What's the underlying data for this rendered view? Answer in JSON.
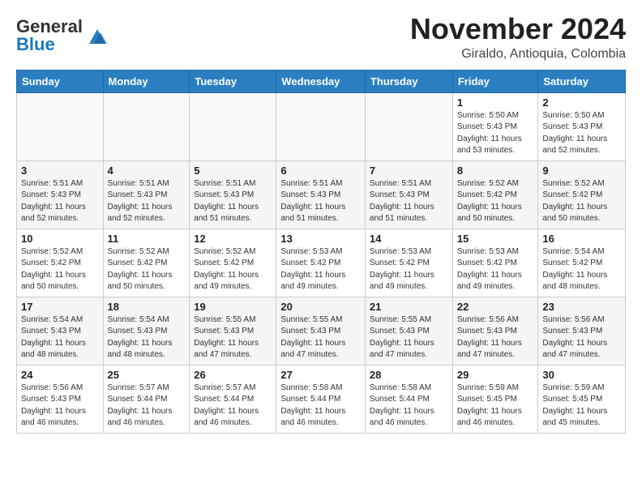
{
  "header": {
    "logo_general": "General",
    "logo_blue": "Blue",
    "month_title": "November 2024",
    "location": "Giraldo, Antioquia, Colombia"
  },
  "weekdays": [
    "Sunday",
    "Monday",
    "Tuesday",
    "Wednesday",
    "Thursday",
    "Friday",
    "Saturday"
  ],
  "weeks": [
    [
      {
        "day": "",
        "info": ""
      },
      {
        "day": "",
        "info": ""
      },
      {
        "day": "",
        "info": ""
      },
      {
        "day": "",
        "info": ""
      },
      {
        "day": "",
        "info": ""
      },
      {
        "day": "1",
        "info": "Sunrise: 5:50 AM\nSunset: 5:43 PM\nDaylight: 11 hours\nand 53 minutes."
      },
      {
        "day": "2",
        "info": "Sunrise: 5:50 AM\nSunset: 5:43 PM\nDaylight: 11 hours\nand 52 minutes."
      }
    ],
    [
      {
        "day": "3",
        "info": "Sunrise: 5:51 AM\nSunset: 5:43 PM\nDaylight: 11 hours\nand 52 minutes."
      },
      {
        "day": "4",
        "info": "Sunrise: 5:51 AM\nSunset: 5:43 PM\nDaylight: 11 hours\nand 52 minutes."
      },
      {
        "day": "5",
        "info": "Sunrise: 5:51 AM\nSunset: 5:43 PM\nDaylight: 11 hours\nand 51 minutes."
      },
      {
        "day": "6",
        "info": "Sunrise: 5:51 AM\nSunset: 5:43 PM\nDaylight: 11 hours\nand 51 minutes."
      },
      {
        "day": "7",
        "info": "Sunrise: 5:51 AM\nSunset: 5:43 PM\nDaylight: 11 hours\nand 51 minutes."
      },
      {
        "day": "8",
        "info": "Sunrise: 5:52 AM\nSunset: 5:42 PM\nDaylight: 11 hours\nand 50 minutes."
      },
      {
        "day": "9",
        "info": "Sunrise: 5:52 AM\nSunset: 5:42 PM\nDaylight: 11 hours\nand 50 minutes."
      }
    ],
    [
      {
        "day": "10",
        "info": "Sunrise: 5:52 AM\nSunset: 5:42 PM\nDaylight: 11 hours\nand 50 minutes."
      },
      {
        "day": "11",
        "info": "Sunrise: 5:52 AM\nSunset: 5:42 PM\nDaylight: 11 hours\nand 50 minutes."
      },
      {
        "day": "12",
        "info": "Sunrise: 5:52 AM\nSunset: 5:42 PM\nDaylight: 11 hours\nand 49 minutes."
      },
      {
        "day": "13",
        "info": "Sunrise: 5:53 AM\nSunset: 5:42 PM\nDaylight: 11 hours\nand 49 minutes."
      },
      {
        "day": "14",
        "info": "Sunrise: 5:53 AM\nSunset: 5:42 PM\nDaylight: 11 hours\nand 49 minutes."
      },
      {
        "day": "15",
        "info": "Sunrise: 5:53 AM\nSunset: 5:42 PM\nDaylight: 11 hours\nand 49 minutes."
      },
      {
        "day": "16",
        "info": "Sunrise: 5:54 AM\nSunset: 5:42 PM\nDaylight: 11 hours\nand 48 minutes."
      }
    ],
    [
      {
        "day": "17",
        "info": "Sunrise: 5:54 AM\nSunset: 5:43 PM\nDaylight: 11 hours\nand 48 minutes."
      },
      {
        "day": "18",
        "info": "Sunrise: 5:54 AM\nSunset: 5:43 PM\nDaylight: 11 hours\nand 48 minutes."
      },
      {
        "day": "19",
        "info": "Sunrise: 5:55 AM\nSunset: 5:43 PM\nDaylight: 11 hours\nand 47 minutes."
      },
      {
        "day": "20",
        "info": "Sunrise: 5:55 AM\nSunset: 5:43 PM\nDaylight: 11 hours\nand 47 minutes."
      },
      {
        "day": "21",
        "info": "Sunrise: 5:55 AM\nSunset: 5:43 PM\nDaylight: 11 hours\nand 47 minutes."
      },
      {
        "day": "22",
        "info": "Sunrise: 5:56 AM\nSunset: 5:43 PM\nDaylight: 11 hours\nand 47 minutes."
      },
      {
        "day": "23",
        "info": "Sunrise: 5:56 AM\nSunset: 5:43 PM\nDaylight: 11 hours\nand 47 minutes."
      }
    ],
    [
      {
        "day": "24",
        "info": "Sunrise: 5:56 AM\nSunset: 5:43 PM\nDaylight: 11 hours\nand 46 minutes."
      },
      {
        "day": "25",
        "info": "Sunrise: 5:57 AM\nSunset: 5:44 PM\nDaylight: 11 hours\nand 46 minutes."
      },
      {
        "day": "26",
        "info": "Sunrise: 5:57 AM\nSunset: 5:44 PM\nDaylight: 11 hours\nand 46 minutes."
      },
      {
        "day": "27",
        "info": "Sunrise: 5:58 AM\nSunset: 5:44 PM\nDaylight: 11 hours\nand 46 minutes."
      },
      {
        "day": "28",
        "info": "Sunrise: 5:58 AM\nSunset: 5:44 PM\nDaylight: 11 hours\nand 46 minutes."
      },
      {
        "day": "29",
        "info": "Sunrise: 5:59 AM\nSunset: 5:45 PM\nDaylight: 11 hours\nand 46 minutes."
      },
      {
        "day": "30",
        "info": "Sunrise: 5:59 AM\nSunset: 5:45 PM\nDaylight: 11 hours\nand 45 minutes."
      }
    ]
  ]
}
